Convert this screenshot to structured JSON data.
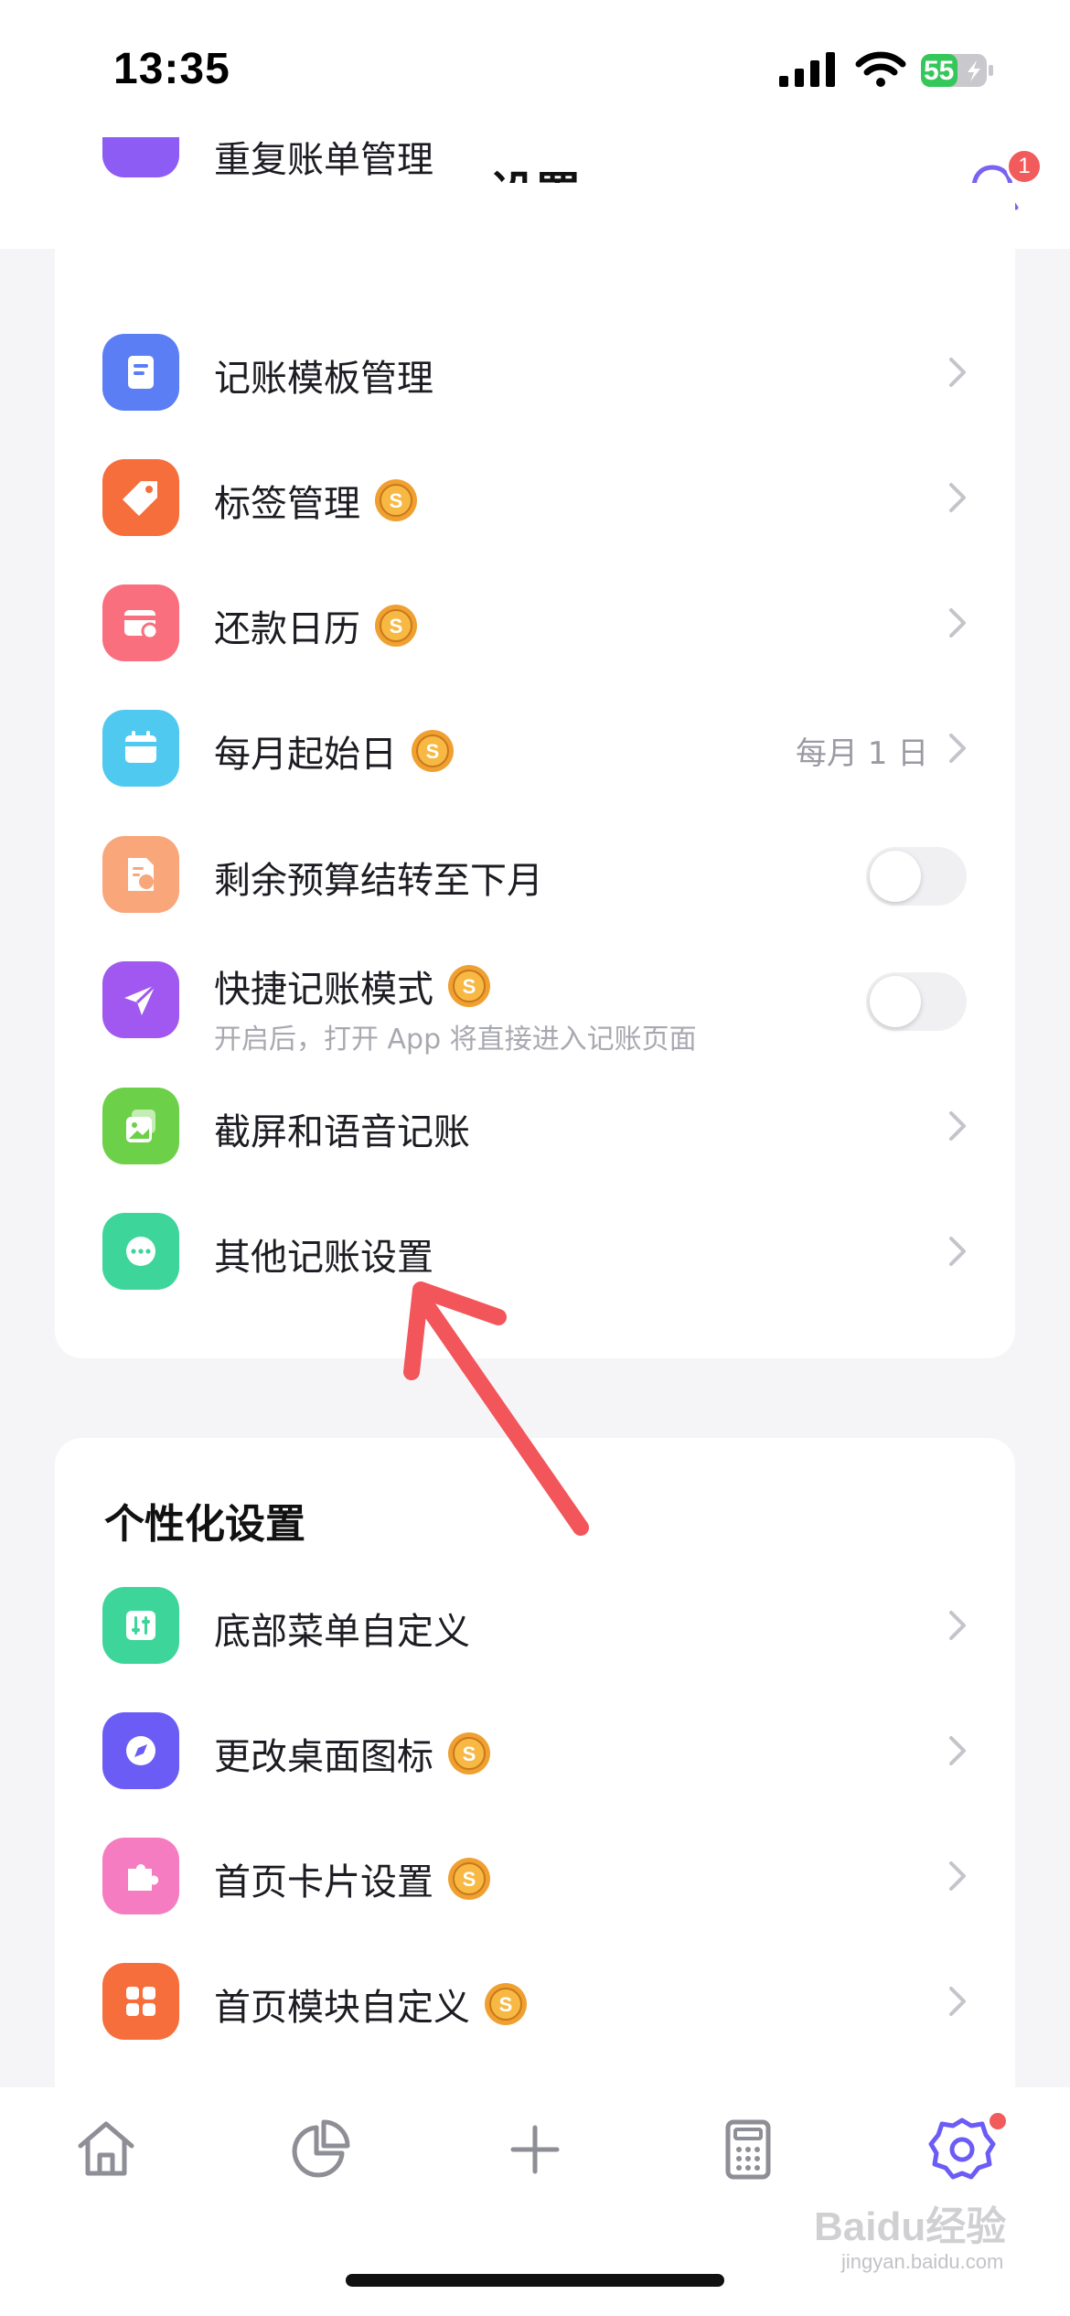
{
  "status_bar": {
    "time": "13:35",
    "battery_level": "55"
  },
  "nav": {
    "title": "设置",
    "notification_count": "1"
  },
  "section1": {
    "partial_item_label": "重复账单管理",
    "items": [
      {
        "label": "记账模板管理",
        "icon": "document-icon",
        "color": "#5b7ef5"
      },
      {
        "label": "标签管理",
        "icon": "tag-icon",
        "color": "#f56e3c",
        "premium": true
      },
      {
        "label": "还款日历",
        "icon": "repayment-calendar-icon",
        "color": "#f96f7e",
        "premium": true
      },
      {
        "label": "每月起始日",
        "icon": "calendar-icon",
        "color": "#4fc9f0",
        "premium": true,
        "value": "每月 1 日"
      },
      {
        "label": "剩余预算结转至下月",
        "icon": "budget-doc-icon",
        "color": "#f9a77a",
        "toggle": false
      },
      {
        "label": "快捷记账模式",
        "icon": "send-icon",
        "color": "#a058f0",
        "premium": true,
        "toggle": false,
        "subtitle": "开启后，打开 App 将直接进入记账页面"
      },
      {
        "label": "截屏和语音记账",
        "icon": "image-icon",
        "color": "#6cd048"
      },
      {
        "label": "其他记账设置",
        "icon": "more-icon",
        "color": "#3dd59a"
      }
    ]
  },
  "section2": {
    "title": "个性化设置",
    "items": [
      {
        "label": "底部菜单自定义",
        "icon": "sliders-icon",
        "color": "#3dd59a"
      },
      {
        "label": "更改桌面图标",
        "icon": "compass-icon",
        "color": "#6b5cf5",
        "premium": true
      },
      {
        "label": "首页卡片设置",
        "icon": "puzzle-icon",
        "color": "#f57cc0",
        "premium": true
      },
      {
        "label": "首页模块自定义",
        "icon": "grid-icon",
        "color": "#f56e3c",
        "premium": true
      }
    ]
  },
  "tabbar": {
    "tabs": [
      "home-icon",
      "pie-chart-icon",
      "plus-icon",
      "calculator-icon",
      "settings-icon"
    ],
    "active": "settings-icon"
  },
  "watermark": {
    "text": "Baidu经验",
    "sub": "jingyan.baidu.com"
  }
}
